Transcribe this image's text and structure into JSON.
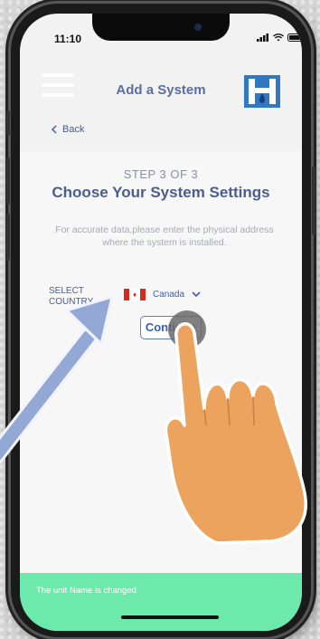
{
  "status_bar": {
    "time": "11:10"
  },
  "header": {
    "title": "Add a System"
  },
  "nav": {
    "back_label": "Back"
  },
  "form": {
    "step": "STEP 3 OF 3",
    "heading": "Choose Your System Settings",
    "description": "For accurate data,please enter the physical address where the system is installed.",
    "select_country_label": "SELECT COUNTRY",
    "country_value": "Canada",
    "continue_label": "Continue"
  },
  "toast": {
    "message": "The unit Name is changed"
  },
  "colors": {
    "brand_text": "#4a5d8e",
    "accent": "#3a5fb8",
    "toast_bg": "#6deaab",
    "logo_blue": "#2f79c2"
  },
  "icons": [
    "menu-icon",
    "brand-logo-icon",
    "chevron-left-icon",
    "canada-flag-icon",
    "chevron-down-icon",
    "signal-icon",
    "wifi-icon",
    "battery-icon"
  ]
}
